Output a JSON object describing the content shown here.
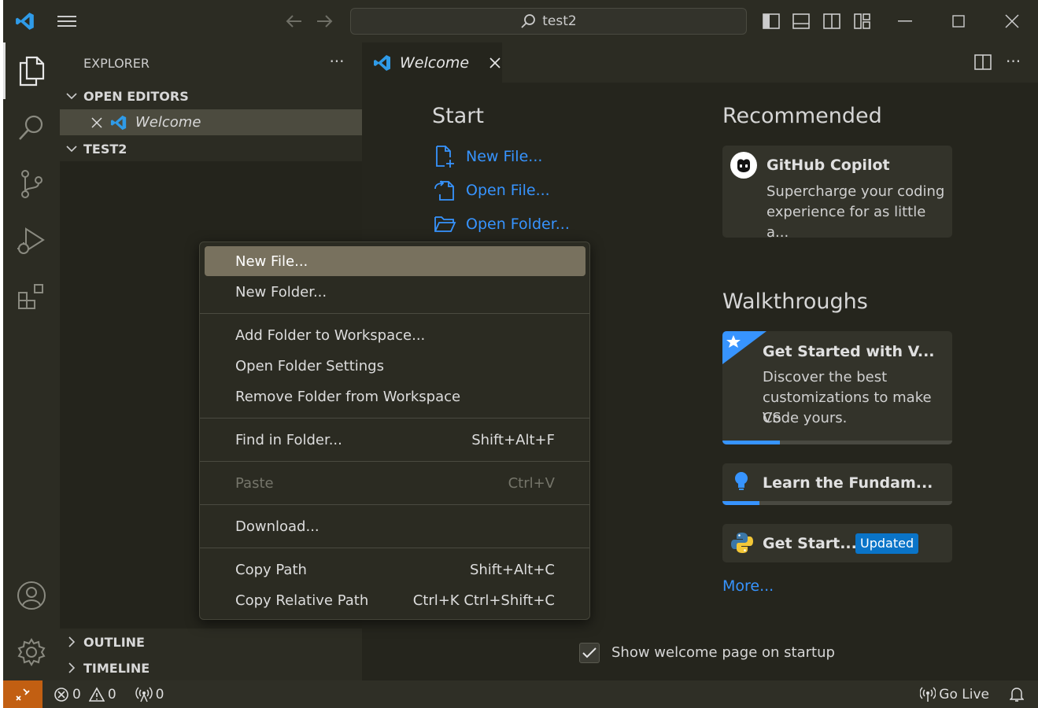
{
  "titlebar": {
    "search_text": "test2"
  },
  "sidebar": {
    "header": "EXPLORER",
    "open_editors_label": "OPEN EDITORS",
    "open_editor_item": "Welcome",
    "folder_label": "TEST2",
    "outline_label": "OUTLINE",
    "timeline_label": "TIMELINE"
  },
  "editor": {
    "tab_label": "Welcome",
    "start_heading": "Start",
    "start_links": [
      "New File...",
      "Open File...",
      "Open Folder..."
    ],
    "recommended_heading": "Recommended",
    "copilot": {
      "title": "GitHub Copilot",
      "desc_line1": "Supercharge your coding",
      "desc_line2": "experience for as little a..."
    },
    "walkthroughs_heading": "Walkthroughs",
    "walkthrough1": {
      "title": "Get Started with V...",
      "desc_line1": "Discover the best",
      "desc_line2": "customizations to make VS",
      "desc_line3": "Code yours.",
      "progress": 0.25
    },
    "walkthrough2": {
      "title": "Learn the Fundam...",
      "progress": 0.16
    },
    "walkthrough3": {
      "title": "Get Start...",
      "badge": "Updated"
    },
    "more_link": "More...",
    "show_on_startup_label": "Show welcome page on startup",
    "show_on_startup_checked": true
  },
  "context_menu": {
    "items": [
      {
        "label": "New File...",
        "shortcut": ""
      },
      {
        "label": "New Folder...",
        "shortcut": ""
      },
      {
        "label": "Add Folder to Workspace...",
        "shortcut": ""
      },
      {
        "label": "Open Folder Settings",
        "shortcut": ""
      },
      {
        "label": "Remove Folder from Workspace",
        "shortcut": ""
      },
      {
        "label": "Find in Folder...",
        "shortcut": "Shift+Alt+F"
      },
      {
        "label": "Paste",
        "shortcut": "Ctrl+V"
      },
      {
        "label": "Download...",
        "shortcut": ""
      },
      {
        "label": "Copy Path",
        "shortcut": "Shift+Alt+C"
      },
      {
        "label": "Copy Relative Path",
        "shortcut": "Ctrl+K Ctrl+Shift+C"
      }
    ]
  },
  "statusbar": {
    "errors": "0",
    "warnings": "0",
    "ports": "0",
    "go_live": "Go Live"
  },
  "colors": {
    "accent": "#3794ff",
    "remote": "#c25f12",
    "menu_highlight": "#78715e"
  }
}
